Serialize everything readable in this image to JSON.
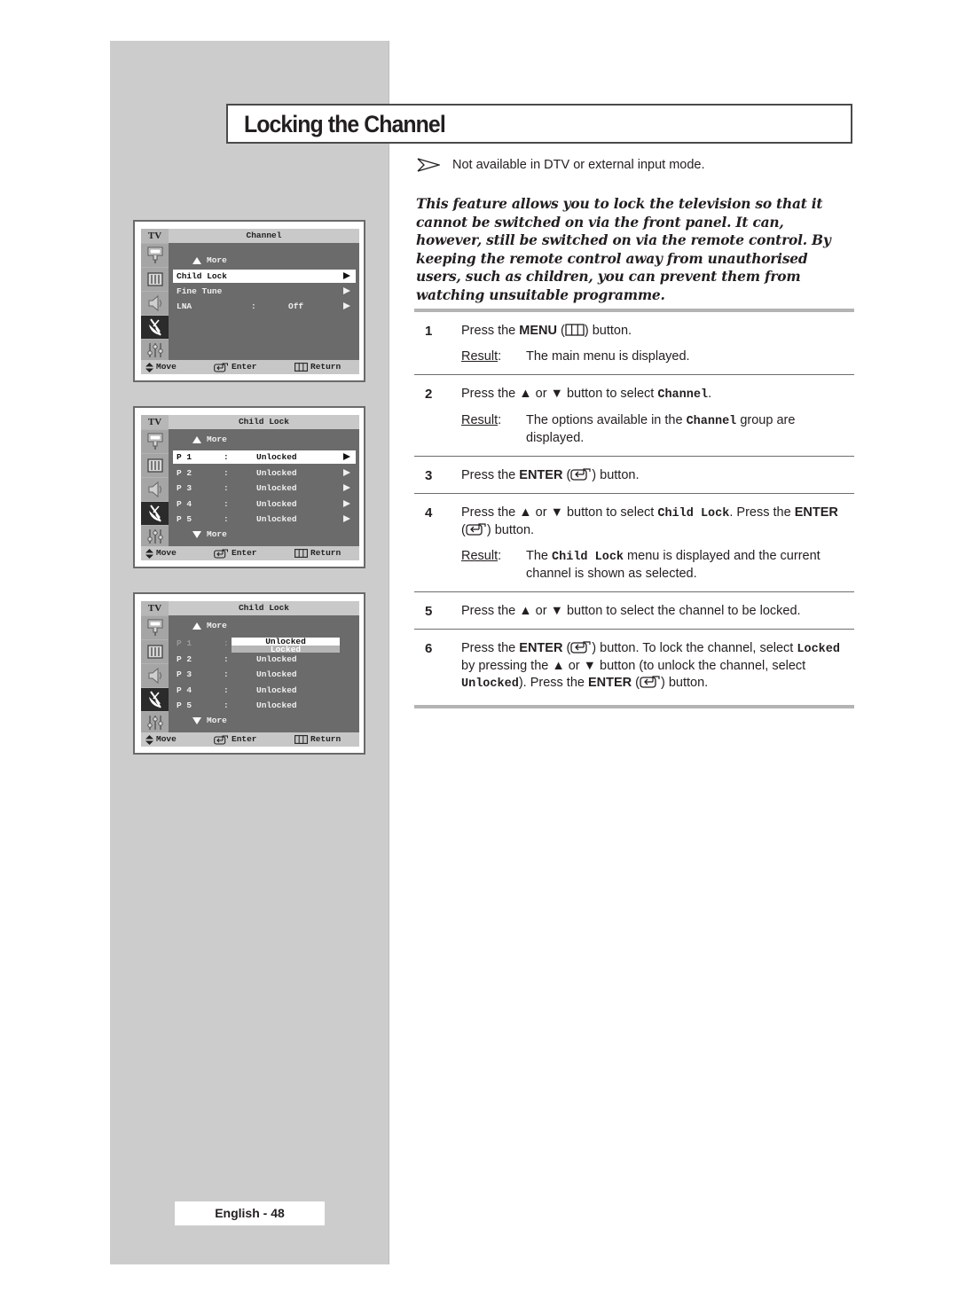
{
  "title": "Locking the Channel",
  "note": "Not available in DTV or external input mode.",
  "intro": "This feature allows you to lock the television so that it cannot be switched on via the front panel. It can, however, still be switched on via the remote control. By keeping the remote control away from unauthorised users, such as children, you can prevent them from watching unsuitable programme.",
  "result_label": "Result",
  "steps": [
    {
      "num": "1",
      "parts": [
        "Press the ",
        "MENU",
        " (",
        ")  button."
      ],
      "result": "The main menu is displayed."
    },
    {
      "num": "2",
      "parts": [
        "Press the ▲ or ▼ button to select ",
        "Channel",
        "."
      ],
      "result_parts": [
        "The options available in the ",
        "Channel",
        " group are displayed."
      ]
    },
    {
      "num": "3",
      "parts": [
        "Press the ",
        "ENTER",
        " (",
        ") button."
      ]
    },
    {
      "num": "4",
      "parts": [
        "Press the ▲ or ▼ button to select ",
        "Child Lock",
        ". Press the ",
        "ENTER",
        " (",
        ") button."
      ],
      "result_parts": [
        "The ",
        "Child Lock",
        " menu is displayed and the current channel is shown as selected."
      ]
    },
    {
      "num": "5",
      "parts": [
        "Press the ▲ or ▼ button to select the channel to be locked."
      ]
    },
    {
      "num": "6",
      "parts": [
        "Press the ",
        "ENTER",
        " (",
        ") button. To lock the channel, select ",
        "Locked",
        " by pressing the ▲ or ▼ button (to unlock the channel, select ",
        "Unlocked",
        "). Press the ",
        "ENTER",
        " (",
        ") button."
      ]
    }
  ],
  "tv_common": {
    "tv_label": "TV",
    "sidebar_icons": [
      "input-icon",
      "picture-icon",
      "sound-icon",
      "channel-antenna-icon",
      "setup-icon"
    ],
    "active_icon_index": 3,
    "footer": {
      "move": "Move",
      "enter": "Enter",
      "return": "Return"
    },
    "more": "More"
  },
  "screens": [
    {
      "header": "Channel",
      "rows": [
        {
          "c1": "Child Lock",
          "c2": "",
          "c3": "",
          "state": "selected"
        },
        {
          "c1": "Fine Tune",
          "c2": "",
          "c3": "",
          "state": "normal"
        },
        {
          "c1": "LNA",
          "c2": ":",
          "c3": "Off",
          "state": "normal"
        }
      ]
    },
    {
      "header": "Child Lock",
      "rows": [
        {
          "c1": "P 1",
          "c2": ":",
          "c3": "Unlocked",
          "state": "selected"
        },
        {
          "c1": "P 2",
          "c2": ":",
          "c3": "Unlocked",
          "state": "normal"
        },
        {
          "c1": "P 3",
          "c2": ":",
          "c3": "Unlocked",
          "state": "normal"
        },
        {
          "c1": "P 4",
          "c2": ":",
          "c3": "Unlocked",
          "state": "normal"
        },
        {
          "c1": "P 5",
          "c2": ":",
          "c3": "Unlocked",
          "state": "normal"
        }
      ]
    },
    {
      "header": "Child Lock",
      "rows": [
        {
          "c1": "P 1",
          "c2": ":",
          "c3": "",
          "state": "dim"
        },
        {
          "c1": "P 2",
          "c2": ":",
          "c3": "Unlocked",
          "state": "normal"
        },
        {
          "c1": "P 3",
          "c2": ":",
          "c3": "Unlocked",
          "state": "normal"
        },
        {
          "c1": "P 4",
          "c2": ":",
          "c3": "Unlocked",
          "state": "normal"
        },
        {
          "c1": "P 5",
          "c2": ":",
          "c3": "Unlocked",
          "state": "normal"
        }
      ],
      "popup_options": [
        "Unlocked",
        "Locked"
      ]
    }
  ],
  "page_number": "English - 48"
}
